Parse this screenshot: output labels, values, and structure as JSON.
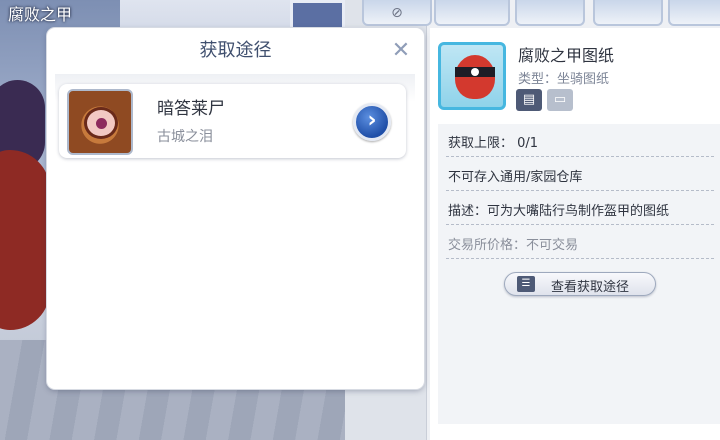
{
  "scene": {
    "title": "腐败之甲"
  },
  "popup": {
    "title": "获取途径",
    "close_icon": "close-icon",
    "sources": [
      {
        "name": "暗答莱尸",
        "location": "古城之泪",
        "thumb_icon": "eye-monster-icon",
        "go_icon": "chevron-right-icon"
      }
    ]
  },
  "item": {
    "name": "腐败之甲图纸",
    "type": "类型：坐骑图纸",
    "icon": "red-masked-creature-icon",
    "info": {
      "limit": "获取上限： 0/1",
      "storage": "不可存入通用/家园仓库",
      "description": "描述：可为大嘴陆行鸟制作盔甲的图纸",
      "trade_price": "交易所价格：不可交易"
    },
    "view_route_label": "查看获取途径"
  },
  "colors": {
    "accent_blue": "#1f4fa8",
    "item_border": "#46b7e0",
    "title_text": "#3f4f6e"
  }
}
